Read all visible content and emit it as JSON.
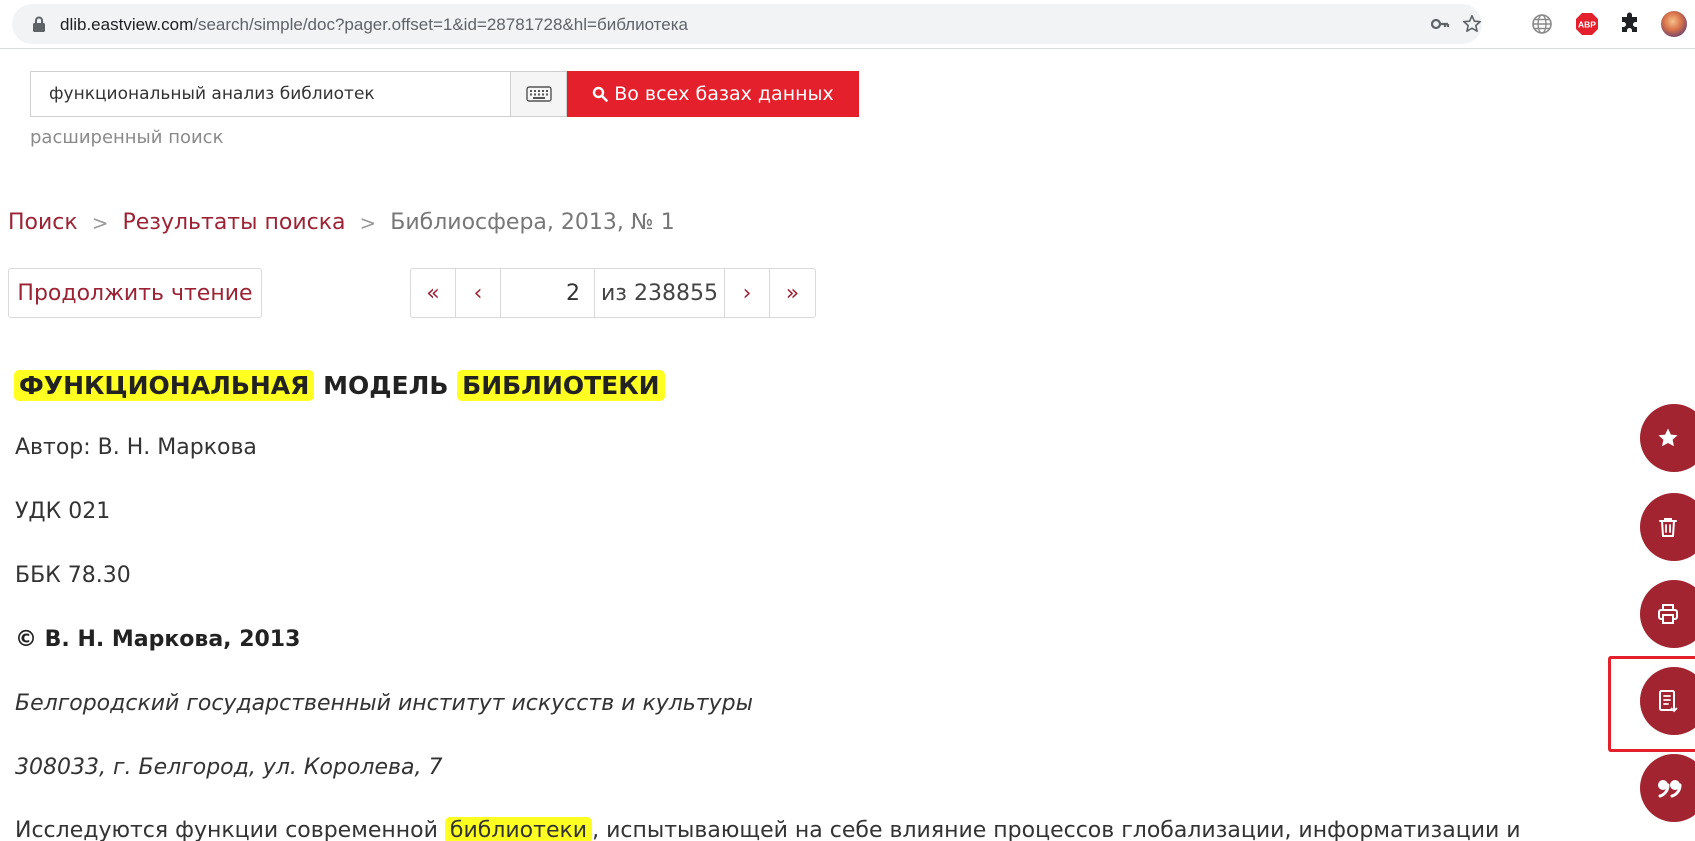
{
  "browser": {
    "url_host": "dlib.eastview.com",
    "url_path": "/search/simple/doc?pager.offset=1&id=28781728&hl=библиотека",
    "icons": [
      "lock-icon",
      "key-icon",
      "star-icon",
      "globe-icon",
      "adblock-icon",
      "extensions-icon",
      "profile-avatar"
    ],
    "adblock_label": "ABP"
  },
  "search": {
    "query": "функциональный анализ библиотек",
    "button_label": "Во всех базах данных",
    "advanced_label": "расширенный поиск"
  },
  "breadcrumb": {
    "items": [
      "Поиск",
      "Результаты поиска"
    ],
    "current": "Библиосфера, 2013, № 1",
    "separator": ">"
  },
  "reader": {
    "continue_label": "Продолжить чтение"
  },
  "pager": {
    "first": "«",
    "prev": "‹",
    "current_page": "2",
    "total_label": "из 238855",
    "next": "›",
    "last": "»"
  },
  "article": {
    "title_hl_1": "ФУНКЦИОНАЛЬНАЯ",
    "title_mid": "МОДЕЛЬ",
    "title_hl_2": "БИБЛИОТЕКИ",
    "author": "Автор: В. Н. Маркова",
    "udk": "УДК 021",
    "bbk": "ББК 78.30",
    "copyright": "© В. Н. Маркова, 2013",
    "institution": "Белгородский государственный институт искусств и культуры",
    "address": "308033, г. Белгород, ул. Королева, 7",
    "abstract_start": "Исследуются функции современной",
    "abstract_hl": "библиотеки",
    "abstract_end": ", испытывающей на себе влияние процессов глобализации, информатизации и"
  },
  "colors": {
    "brand_red": "#e3202c",
    "link": "#9b2335",
    "fab": "#a12430",
    "highlight": "#ffff22"
  },
  "fab_icons": [
    "star-icon",
    "trash-icon",
    "print-icon",
    "export-icon",
    "quote-icon"
  ]
}
